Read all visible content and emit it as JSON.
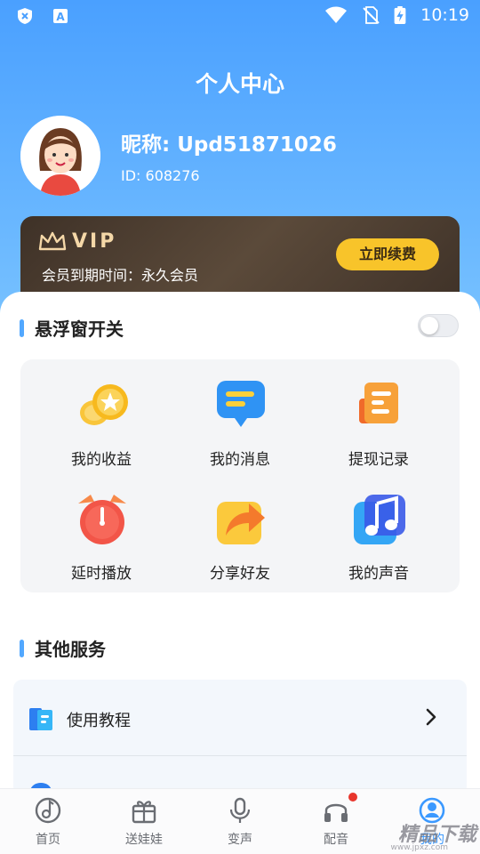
{
  "status_bar": {
    "time": "10:19",
    "left_icons": [
      "vpn-shield-icon",
      "keyboard-a-icon"
    ],
    "right_icons": [
      "wifi-icon",
      "no-sim-icon",
      "battery-charging-icon"
    ]
  },
  "header": {
    "title": "个人中心"
  },
  "profile": {
    "nickname": "昵称: Upd51871026",
    "user_id": "ID: 608276",
    "avatar": "girl-avatar"
  },
  "vip": {
    "badge": "VIP",
    "expire_text": "会员到期时间：永久会员",
    "renew_label": "立即续费"
  },
  "floating_window": {
    "title": "悬浮窗开关",
    "enabled": false
  },
  "features": [
    {
      "label": "我的收益",
      "icon": "coin-icon"
    },
    {
      "label": "我的消息",
      "icon": "message-icon"
    },
    {
      "label": "提现记录",
      "icon": "record-icon"
    },
    {
      "label": "延时播放",
      "icon": "alarm-clock-icon"
    },
    {
      "label": "分享好友",
      "icon": "share-icon"
    },
    {
      "label": "我的声音",
      "icon": "music-note-icon"
    }
  ],
  "other_services": {
    "title": "其他服务",
    "items": [
      {
        "label": "使用教程",
        "icon": "tutorial-book-icon"
      }
    ]
  },
  "tabbar": {
    "active": "我的",
    "tabs": [
      {
        "label": "首页",
        "icon": "home-disc-icon"
      },
      {
        "label": "送娃娃",
        "icon": "gift-box-icon"
      },
      {
        "label": "变声",
        "icon": "microphone-icon"
      },
      {
        "label": "配音",
        "icon": "headphones-icon"
      },
      {
        "label": "我的",
        "icon": "profile-icon"
      }
    ]
  },
  "watermark": {
    "text": "精品下载",
    "sub": "www.jpxz.com"
  },
  "colors": {
    "primary": "#4aa0ff",
    "vip_gold": "#f8c42a",
    "vip_dark": "#3e3127",
    "active_tab": "#3b99ff"
  }
}
